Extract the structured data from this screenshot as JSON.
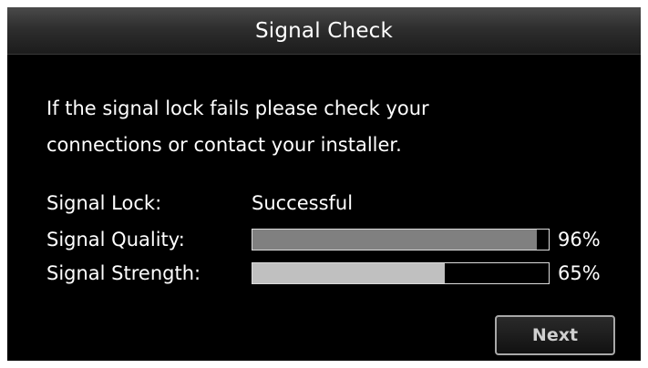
{
  "dialog": {
    "title": "Signal Check",
    "message_line1": "If the signal lock fails please check your",
    "message_line2": "connections or contact your installer."
  },
  "signal_lock": {
    "label": "Signal Lock:",
    "value": "Successful"
  },
  "signal_quality": {
    "label": "Signal Quality:",
    "percent": 96,
    "percent_text": "96%",
    "fill_color": "#808080"
  },
  "signal_strength": {
    "label": "Signal Strength:",
    "percent": 65,
    "percent_text": "65%",
    "fill_color": "#c0c0c0"
  },
  "buttons": {
    "next_label": "Next"
  }
}
